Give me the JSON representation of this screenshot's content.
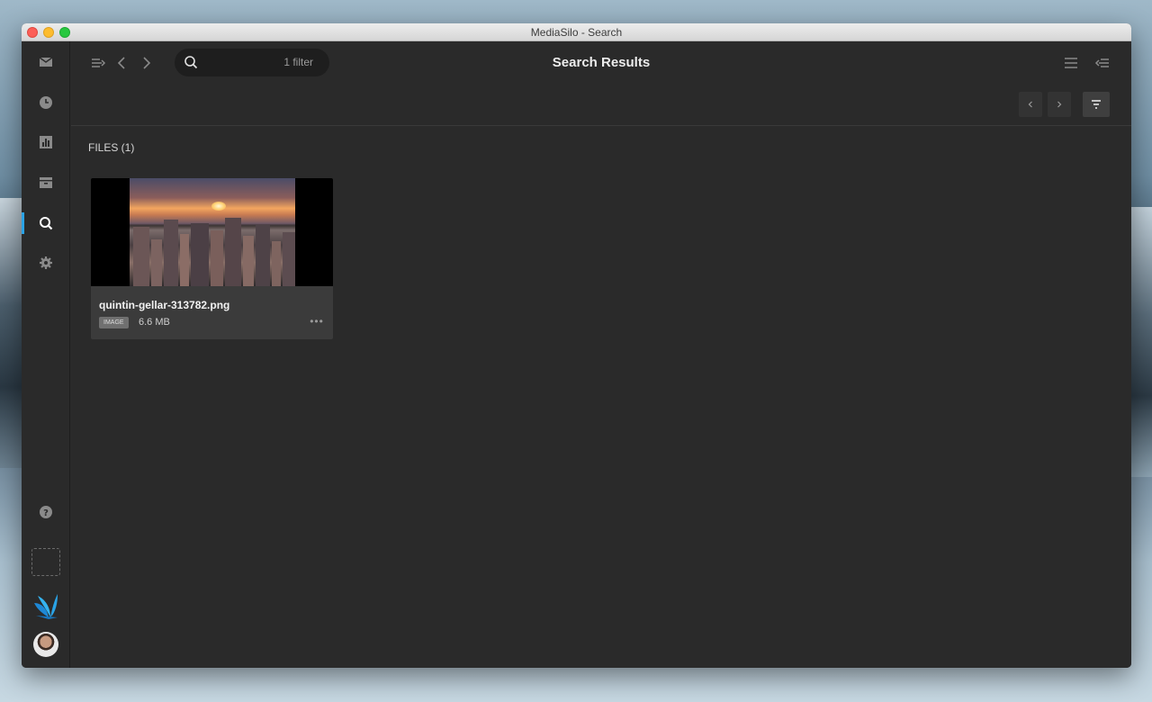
{
  "window": {
    "title": "MediaSilo - Search"
  },
  "sidebar": {
    "items": [
      {
        "name": "inbox-icon"
      },
      {
        "name": "recent-icon"
      },
      {
        "name": "analytics-icon"
      },
      {
        "name": "archive-icon"
      },
      {
        "name": "search-icon",
        "active": true
      },
      {
        "name": "settings-icon"
      }
    ],
    "help_icon": "help-icon",
    "accent": "#2aa3e6"
  },
  "toolbar": {
    "search_filter_text": "1 filter",
    "page_title": "Search Results"
  },
  "results": {
    "section_label": "FILES (1)",
    "files": [
      {
        "name": "quintin-gellar-313782.png",
        "type_badge": "IMAGE",
        "size": "6.6 MB"
      }
    ]
  }
}
